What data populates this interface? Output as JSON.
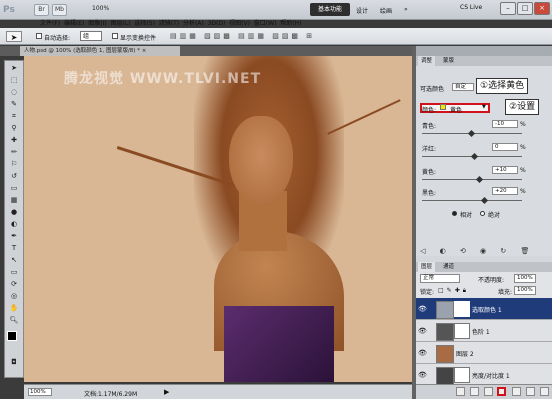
{
  "app": {
    "logo": "Ps"
  },
  "quick_buttons": [
    "Br",
    "Mb",
    "100%"
  ],
  "menu": [
    "文件(F)",
    "编辑(E)",
    "图像(I)",
    "图层(L)",
    "选择(S)",
    "滤镜(T)",
    "分析(A)",
    "3D(D)",
    "视图(V)",
    "窗口(W)",
    "帮助(H)"
  ],
  "workspace": {
    "active": "基本功能",
    "items": [
      "设计",
      "绘画",
      "»"
    ],
    "cslive": "CS Live"
  },
  "options": {
    "auto_select_label": "自动选择:",
    "auto_select_value": "组",
    "transform_label": "显示变换控件"
  },
  "document": {
    "tab": "人物.psd @ 100% (选取颜色 1, 图层蒙版/8) *",
    "close": "×"
  },
  "watermark": "腾龙视觉 WWW.TLVI.NET",
  "status": {
    "zoom": "100%",
    "doc": "文档:1.17M/6.29M"
  },
  "adjustments": {
    "tabs": [
      "调整",
      "蒙版"
    ],
    "title": "可选颜色",
    "preset": "自定",
    "color_label": "颜色:",
    "color_value": "黄色",
    "rows": [
      {
        "label": "青色:",
        "value": "-10",
        "unit": "%"
      },
      {
        "label": "洋红:",
        "value": "0",
        "unit": "%"
      },
      {
        "label": "黄色:",
        "value": "+10",
        "unit": "%"
      },
      {
        "label": "黑色:",
        "value": "+20",
        "unit": "%"
      }
    ],
    "method_relative": "相对",
    "method_absolute": "绝对"
  },
  "callouts": {
    "step1": "①选择黄色",
    "step2": "②设置"
  },
  "layers": {
    "tabs": [
      "图层",
      "通道"
    ],
    "blend": "正常",
    "opacity_label": "不透明度:",
    "opacity": "100%",
    "lock_label": "锁定:",
    "fill_label": "填充:",
    "fill": "100%",
    "items": [
      {
        "name": "选取颜色 1",
        "selected": true
      },
      {
        "name": "色阶 1",
        "selected": false
      },
      {
        "name": "图层 2",
        "selected": false
      },
      {
        "name": "亮度/对比度 1",
        "selected": false
      }
    ]
  },
  "colors": {
    "accent_red": "#d0121b",
    "selected_layer": "#1f3b7a"
  }
}
